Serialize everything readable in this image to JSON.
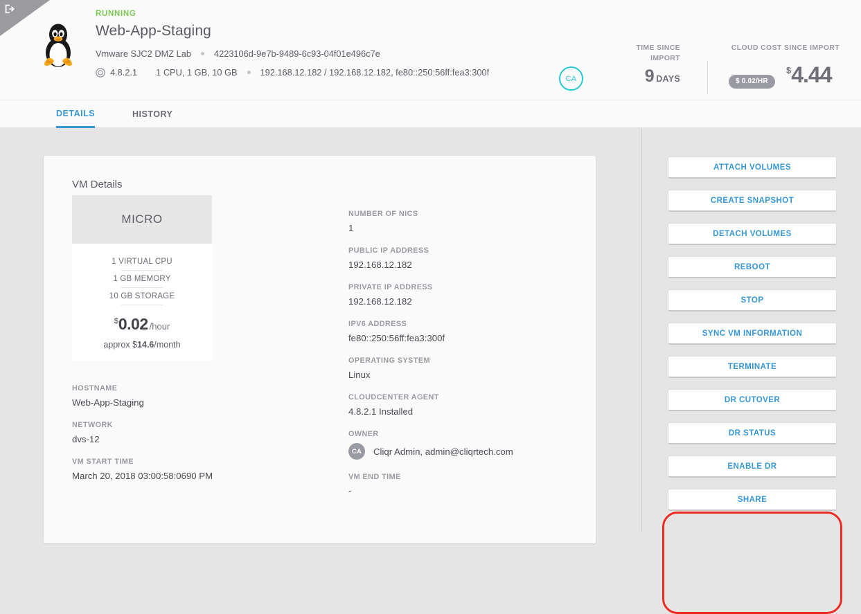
{
  "corner": {
    "icon": "login-arrow-icon"
  },
  "header": {
    "os_icon": "linux-penguin-icon",
    "status": "RUNNING",
    "title": "Web-App-Staging",
    "cloud": "Vmware SJC2 DMZ Lab",
    "uuid": "4223106d-9e7b-9489-6c93-04f01e496c7e",
    "agent_icon": "target-ring-icon",
    "agent_version": "4.8.2.1",
    "resources": "1 CPU, 1 GB, 10 GB",
    "ips": "192.168.12.182 / 192.168.12.182, fe80::250:56ff:fea3:300f",
    "user_badge": "CA",
    "time_since_import_label": "TIME SINCE IMPORT",
    "time_since_import_value": "9",
    "time_since_import_unit": "DAYS",
    "cloud_cost_label": "CLOUD COST SINCE IMPORT",
    "rate_pill": "$ 0.02/HR",
    "cost_currency": "$",
    "cost_value": "4.44"
  },
  "tabs": [
    {
      "label": "DETAILS",
      "active": true
    },
    {
      "label": "HISTORY",
      "active": false
    }
  ],
  "details": {
    "card_title": "VM Details",
    "spec": {
      "tier": "MICRO",
      "lines": [
        "1 VIRTUAL CPU",
        "1 GB MEMORY",
        "10 GB STORAGE"
      ],
      "price_currency": "$",
      "price_amount": "0.02",
      "price_period": "/hour",
      "monthly_prefix": "approx $",
      "monthly_amount": "14.6",
      "monthly_suffix": "/month"
    },
    "left_fields": [
      {
        "label": "HOSTNAME",
        "value": "Web-App-Staging"
      },
      {
        "label": "NETWORK",
        "value": "dvs-12"
      },
      {
        "label": "VM START TIME",
        "value": "March 20, 2018 03:00:58:0690 PM"
      }
    ],
    "mid_fields": [
      {
        "label": "NUMBER OF NICS",
        "value": "1"
      },
      {
        "label": "PUBLIC IP ADDRESS",
        "value": "192.168.12.182"
      },
      {
        "label": "PRIVATE IP ADDRESS",
        "value": "192.168.12.182"
      },
      {
        "label": "IPV6 ADDRESS",
        "value": "fe80::250:56ff:fea3:300f"
      },
      {
        "label": "OPERATING SYSTEM",
        "value": "Linux"
      },
      {
        "label": "CLOUDCENTER AGENT",
        "value": "4.8.2.1 Installed"
      }
    ],
    "owner": {
      "label": "OWNER",
      "avatar": "CA",
      "value": "Cliqr Admin, admin@cliqrtech.com"
    },
    "vm_end_time": {
      "label": "VM END TIME",
      "value": "-"
    }
  },
  "actions": [
    {
      "label": "ATTACH VOLUMES"
    },
    {
      "label": "CREATE SNAPSHOT"
    },
    {
      "label": "DETACH VOLUMES"
    },
    {
      "label": "REBOOT"
    },
    {
      "label": "STOP"
    },
    {
      "label": "SYNC VM INFORMATION"
    },
    {
      "label": "TERMINATE"
    },
    {
      "label": "DR CUTOVER"
    },
    {
      "label": "DR STATUS"
    },
    {
      "label": "ENABLE DR"
    },
    {
      "label": "SHARE"
    }
  ],
  "colors": {
    "accent_blue": "#3697d4",
    "status_green": "#7dc855",
    "badge_cyan": "#25c9d6",
    "highlight_red": "#ee2b22",
    "muted_gray": "#9a9aa2"
  }
}
